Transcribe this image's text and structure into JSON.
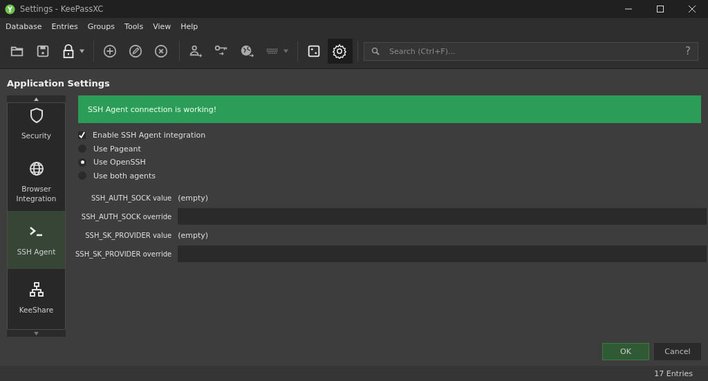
{
  "window": {
    "title": "Settings - KeePassXC"
  },
  "menu": [
    "Database",
    "Entries",
    "Groups",
    "Tools",
    "View",
    "Help"
  ],
  "toolbar": {
    "groups": [
      {
        "buttons": [
          {
            "kind": "open",
            "selected": false,
            "disabled": false,
            "dropdown": false
          },
          {
            "kind": "save",
            "selected": false,
            "disabled": false,
            "dropdown": false
          },
          {
            "kind": "lock",
            "selected": false,
            "disabled": false,
            "dropdown": true
          }
        ]
      },
      {
        "buttons": [
          {
            "kind": "add",
            "selected": false,
            "disabled": false,
            "dropdown": false
          },
          {
            "kind": "edit",
            "selected": false,
            "disabled": false,
            "dropdown": false
          },
          {
            "kind": "delete",
            "selected": false,
            "disabled": false,
            "dropdown": false
          }
        ]
      },
      {
        "buttons": [
          {
            "kind": "user",
            "selected": false,
            "disabled": false,
            "dropdown": false
          },
          {
            "kind": "key",
            "selected": false,
            "disabled": false,
            "dropdown": false
          },
          {
            "kind": "globe",
            "selected": false,
            "disabled": false,
            "dropdown": false
          },
          {
            "kind": "keyboard",
            "selected": false,
            "disabled": true,
            "dropdown": true
          }
        ]
      },
      {
        "buttons": [
          {
            "kind": "dice",
            "selected": false,
            "disabled": false,
            "dropdown": false
          },
          {
            "kind": "settings",
            "selected": true,
            "disabled": false,
            "dropdown": false
          }
        ]
      }
    ]
  },
  "search": {
    "placeholder": "Search (Ctrl+F)...",
    "help": "?"
  },
  "heading": "Application Settings",
  "sidebar": {
    "items": [
      {
        "kind": "shield",
        "label": "Security",
        "selected": false
      },
      {
        "kind": "globe",
        "label": "Browser Integration",
        "selected": false
      },
      {
        "kind": "terminal",
        "label": "SSH Agent",
        "selected": true
      },
      {
        "kind": "network",
        "label": "KeeShare",
        "selected": false
      }
    ]
  },
  "banner": {
    "text": "SSH Agent connection is working!"
  },
  "enable": {
    "label": "Enable SSH Agent integration",
    "checked": true
  },
  "agents": [
    {
      "label": "Use Pageant",
      "selected": false
    },
    {
      "label": "Use OpenSSH",
      "selected": true
    },
    {
      "label": "Use both agents",
      "selected": false
    }
  ],
  "env": [
    {
      "kind": "value",
      "label": "SSH_AUTH_SOCK value",
      "value": "(empty)"
    },
    {
      "kind": "override",
      "label": "SSH_AUTH_SOCK override"
    },
    {
      "kind": "value",
      "label": "SSH_SK_PROVIDER value",
      "value": "(empty)"
    },
    {
      "kind": "override",
      "label": "SSH_SK_PROVIDER override"
    }
  ],
  "buttons": [
    {
      "kind": "primary",
      "label": "OK"
    },
    {
      "kind": "secondary",
      "label": "Cancel"
    }
  ],
  "status_bar": {
    "text": "17 Entries"
  }
}
